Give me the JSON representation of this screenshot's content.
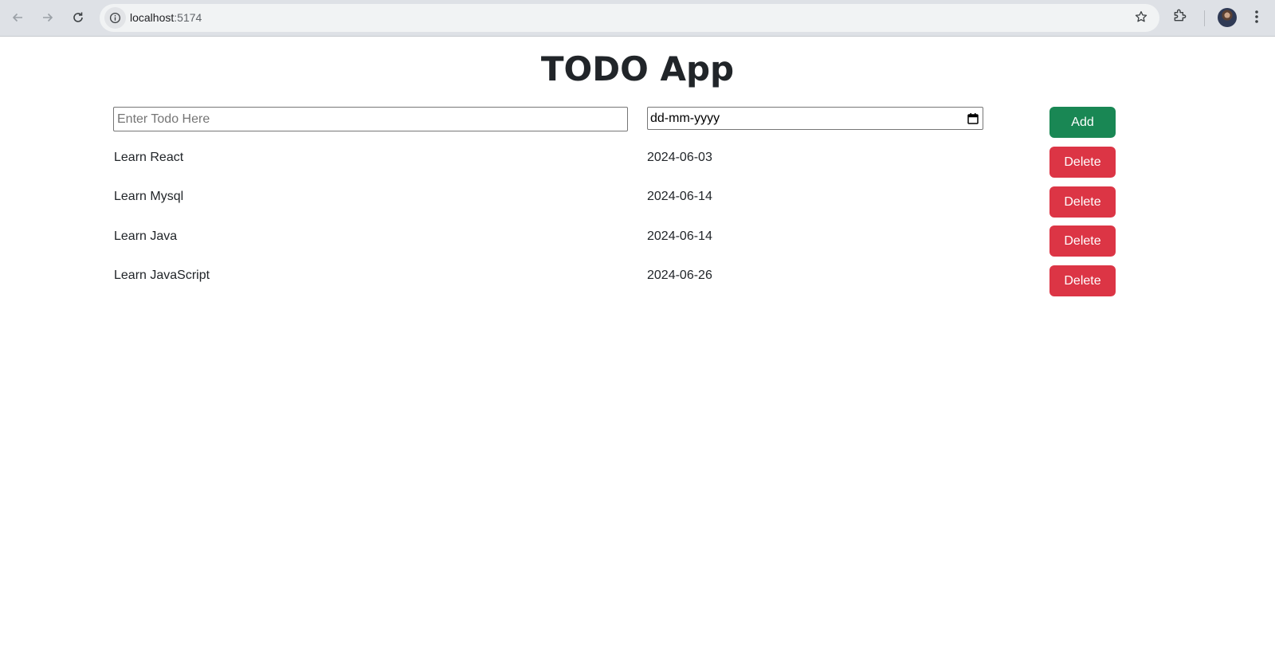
{
  "browser": {
    "url_host": "localhost",
    "url_port": ":5174"
  },
  "app": {
    "title": "TODO App",
    "form": {
      "todo_placeholder": "Enter Todo Here",
      "date_placeholder": "dd-mm-yyyy",
      "add_label": "Add"
    },
    "todos": [
      {
        "name": "Learn React",
        "date": "2024-06-03",
        "delete_label": "Delete"
      },
      {
        "name": "Learn Mysql",
        "date": "2024-06-14",
        "delete_label": "Delete"
      },
      {
        "name": "Learn Java",
        "date": "2024-06-14",
        "delete_label": "Delete"
      },
      {
        "name": "Learn JavaScript",
        "date": "2024-06-26",
        "delete_label": "Delete"
      }
    ]
  },
  "colors": {
    "add": "#198754",
    "delete": "#dc3545",
    "text": "#212529",
    "chrome": "#dee1e6"
  },
  "icons": [
    "back-arrow-icon",
    "forward-arrow-icon",
    "reload-icon",
    "info-icon",
    "star-icon",
    "extensions-icon",
    "avatar",
    "more-menu-icon",
    "calendar-icon"
  ]
}
